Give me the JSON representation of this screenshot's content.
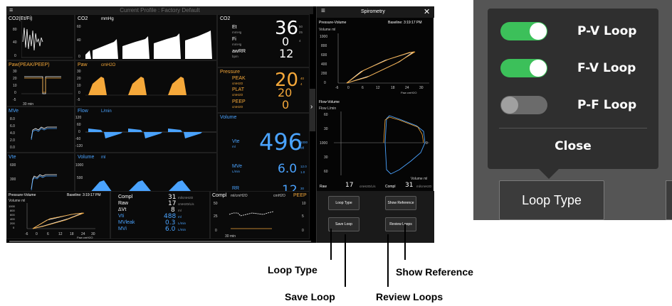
{
  "monitor": {
    "profile_title": "Current Profile : Factory Default",
    "waves": [
      {
        "param": "CO2(Et/Fi)",
        "ticks": [
          "80",
          "40",
          "0"
        ],
        "xlabel": "30 min"
      },
      {
        "param": "Paw(PEAK/PEEP)",
        "ticks": [
          "30",
          "20",
          "10",
          "0",
          "-5"
        ],
        "xlabel": "30 min"
      },
      {
        "param": "MVe",
        "ticks": [
          "8.0",
          "6.0",
          "4.0",
          "2.0",
          "0.0"
        ],
        "xlabel": "30 min"
      },
      {
        "param": "Vte",
        "ticks": [
          "600",
          "300",
          "0"
        ],
        "xlabel": "30 min"
      }
    ],
    "curves": [
      {
        "title": "CO2",
        "unit": "mmHg",
        "ticks": [
          "60",
          "40",
          "0"
        ]
      },
      {
        "title": "Paw",
        "unit": "cmH2O",
        "ticks": [
          "30",
          "20",
          "10",
          "0",
          "-5"
        ]
      },
      {
        "title": "Flow",
        "unit": "L/min",
        "ticks": [
          "120",
          "60",
          "0",
          "-60",
          "-120"
        ]
      },
      {
        "title": "Volume",
        "unit": "ml",
        "ticks": [
          "1000",
          "500",
          "0"
        ]
      }
    ],
    "numerics": {
      "co2": {
        "title": "CO2",
        "et_label": "Et",
        "et_unit": "mmHg",
        "et_value": "36",
        "et_limits": [
          "50",
          "25"
        ],
        "fi_label": "Fi",
        "fi_unit": "mmHg",
        "fi_value": "0",
        "fi_limit": "4",
        "awrr_label": "awRR",
        "awrr_unit": "bpm",
        "awrr_value": "12"
      },
      "pressure": {
        "title": "Pressure",
        "peak_label": "PEAK",
        "peak_unit": "cmH2O",
        "peak_value": "20",
        "peak_limits": [
          "40",
          "4"
        ],
        "plat_label": "PLAT",
        "plat_unit": "cmH2O",
        "plat_value": "20",
        "peep_label": "PEEP",
        "peep_unit": "cmH2O",
        "peep_value": "0"
      },
      "volume": {
        "title": "Volume",
        "vte_label": "Vte",
        "vte_unit": "ml",
        "vte_value": "496",
        "vte_limits": [
          "1000",
          "0ff"
        ],
        "mve_label": "MVe",
        "mve_unit": "L/min",
        "mve_value": "6.0",
        "mve_limits": [
          "12.0",
          "1.0"
        ],
        "rr_label": "RR",
        "rr_unit": "bpm",
        "rr_value": "12",
        "rr_limits": [
          "30",
          "6"
        ]
      }
    },
    "bottom": {
      "pv_title": "Pressure-Volume",
      "pv_baseline": "Baseline: 3:19:17 PM",
      "pv_ylabel": "Volume ml",
      "pv_yticks": [
        "1000",
        "800",
        "600",
        "400",
        "200",
        "0"
      ],
      "pv_xticks": [
        "-6",
        "0",
        "6",
        "12",
        "18",
        "24",
        "30"
      ],
      "pv_xunit": "Paw cmH2O",
      "table": [
        {
          "label": "Compl",
          "value": "31",
          "unit": "ml/cmH2O"
        },
        {
          "label": "Raw",
          "value": "17",
          "unit": "cmH2O/L/s"
        },
        {
          "label": "ΔVt",
          "value": "8",
          "unit": "ml"
        },
        {
          "label": "Vti",
          "value": "488",
          "unit": "ml"
        },
        {
          "label": "MVleak",
          "value": "0.3",
          "unit": "L/min"
        },
        {
          "label": "MVi",
          "value": "6.0",
          "unit": "L/min"
        }
      ],
      "trend_title": "Compl",
      "trend_unit1": "ml/cmH2O",
      "trend_unit2": "cmH2O",
      "trend_title2": "PEEP",
      "trend_ticks_left": [
        "50",
        "25",
        "0"
      ],
      "trend_ticks_right": [
        "10",
        "5",
        "0"
      ],
      "trend_xlabel": "30 min"
    },
    "spiro": {
      "title": "Spirometry",
      "pv_title": "Pressure-Volume",
      "pv_baseline": "Baseline: 3:19:17 PM",
      "pv_ylabel": "Volume ml",
      "pv_yticks": [
        "1000",
        "800",
        "600",
        "400",
        "200",
        "0"
      ],
      "pv_xticks": [
        "-6",
        "0",
        "6",
        "12",
        "18",
        "24",
        "30"
      ],
      "pv_xunit": "Paw cmH2O",
      "fv_title": "Flow-Volume",
      "fv_ylabel": "Flow L/min",
      "fv_yticks": [
        "60",
        "30",
        "1000",
        "30",
        "60"
      ],
      "fv_xunit": "Volume ml",
      "fv_zero": "0",
      "raw_label": "Raw",
      "raw_value": "17",
      "raw_unit": "cmH2O/L/s",
      "compl_label": "Compl",
      "compl_value": "31",
      "compl_unit": "ml/cmH2O",
      "buttons": {
        "loop_type": "Loop Type",
        "show_reference": "Show Reference",
        "save_loop": "Save Loop",
        "review_loops": "Review Loops"
      }
    }
  },
  "annotations": {
    "loop_type": "Loop Type",
    "show_reference": "Show Reference",
    "save_loop": "Save Loop",
    "review_loops": "Review Loops"
  },
  "popup": {
    "items": [
      {
        "label": "P-V Loop",
        "on": true
      },
      {
        "label": "F-V Loop",
        "on": true
      },
      {
        "label": "P-F Loop",
        "on": false
      }
    ],
    "close_label": "Close",
    "button_label": "Loop Type"
  },
  "colors": {
    "orange": "#f5a83a",
    "blue": "#4aa3ff",
    "toggle_on": "#3cc05a",
    "toggle_off": "#6b6b6b"
  }
}
